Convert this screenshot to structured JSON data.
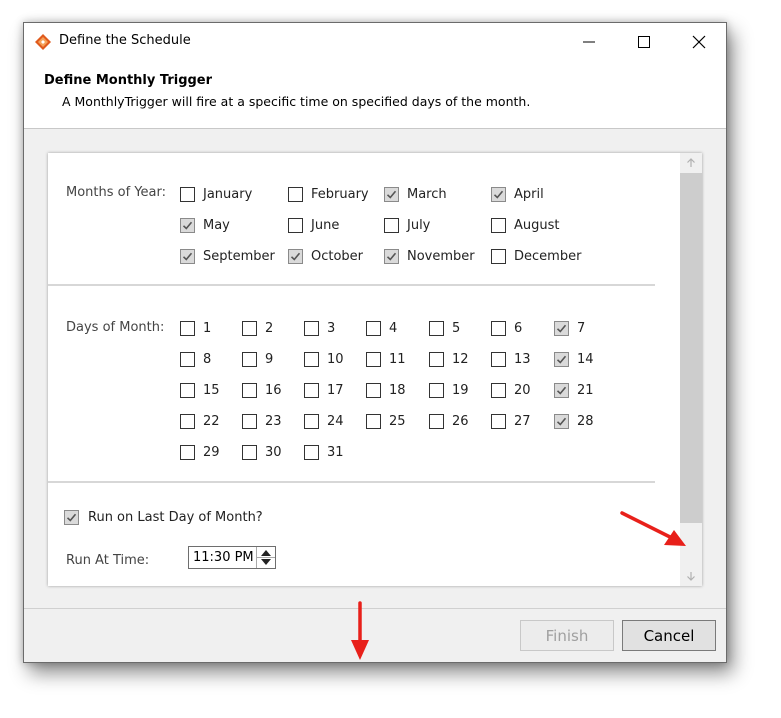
{
  "window": {
    "title": "Define the Schedule",
    "minimize_glyph": "—",
    "maximize_glyph": "☐",
    "close_glyph": "✕"
  },
  "header": {
    "title": "Define Monthly Trigger",
    "description": "A MonthlyTrigger will fire at a specific time on specified days of the month."
  },
  "months_section": {
    "label": "Months of Year:",
    "months": [
      {
        "name": "January",
        "checked": false
      },
      {
        "name": "February",
        "checked": false
      },
      {
        "name": "March",
        "checked": true
      },
      {
        "name": "April",
        "checked": true
      },
      {
        "name": "May",
        "checked": true
      },
      {
        "name": "June",
        "checked": false
      },
      {
        "name": "July",
        "checked": false
      },
      {
        "name": "August",
        "checked": false
      },
      {
        "name": "September",
        "checked": true
      },
      {
        "name": "October",
        "checked": true
      },
      {
        "name": "November",
        "checked": true
      },
      {
        "name": "December",
        "checked": false
      }
    ]
  },
  "days_section": {
    "label": "Days of Month:",
    "days": [
      {
        "name": "1",
        "checked": false
      },
      {
        "name": "2",
        "checked": false
      },
      {
        "name": "3",
        "checked": false
      },
      {
        "name": "4",
        "checked": false
      },
      {
        "name": "5",
        "checked": false
      },
      {
        "name": "6",
        "checked": false
      },
      {
        "name": "7",
        "checked": true
      },
      {
        "name": "8",
        "checked": false
      },
      {
        "name": "9",
        "checked": false
      },
      {
        "name": "10",
        "checked": false
      },
      {
        "name": "11",
        "checked": false
      },
      {
        "name": "12",
        "checked": false
      },
      {
        "name": "13",
        "checked": false
      },
      {
        "name": "14",
        "checked": true
      },
      {
        "name": "15",
        "checked": false
      },
      {
        "name": "16",
        "checked": false
      },
      {
        "name": "17",
        "checked": false
      },
      {
        "name": "18",
        "checked": false
      },
      {
        "name": "19",
        "checked": false
      },
      {
        "name": "20",
        "checked": false
      },
      {
        "name": "21",
        "checked": true
      },
      {
        "name": "22",
        "checked": false
      },
      {
        "name": "23",
        "checked": false
      },
      {
        "name": "24",
        "checked": false
      },
      {
        "name": "25",
        "checked": false
      },
      {
        "name": "26",
        "checked": false
      },
      {
        "name": "27",
        "checked": false
      },
      {
        "name": "28",
        "checked": true
      },
      {
        "name": "29",
        "checked": false
      },
      {
        "name": "30",
        "checked": false
      },
      {
        "name": "31",
        "checked": false
      }
    ]
  },
  "last_day": {
    "label": "Run on Last Day of Month?",
    "checked": true
  },
  "run_at": {
    "label": "Run At Time:",
    "value": "11:30 PM"
  },
  "footer": {
    "finish_label": "Finish",
    "cancel_label": "Cancel"
  },
  "colors": {
    "annotation_arrow": "#e8201a",
    "app_icon": "#e05a1c",
    "checkbox_checked": "#dadada"
  },
  "icons": {
    "app": "app-logo-icon",
    "scroll_up": "scroll-up-arrow-icon",
    "scroll_down": "scroll-down-arrow-icon"
  }
}
